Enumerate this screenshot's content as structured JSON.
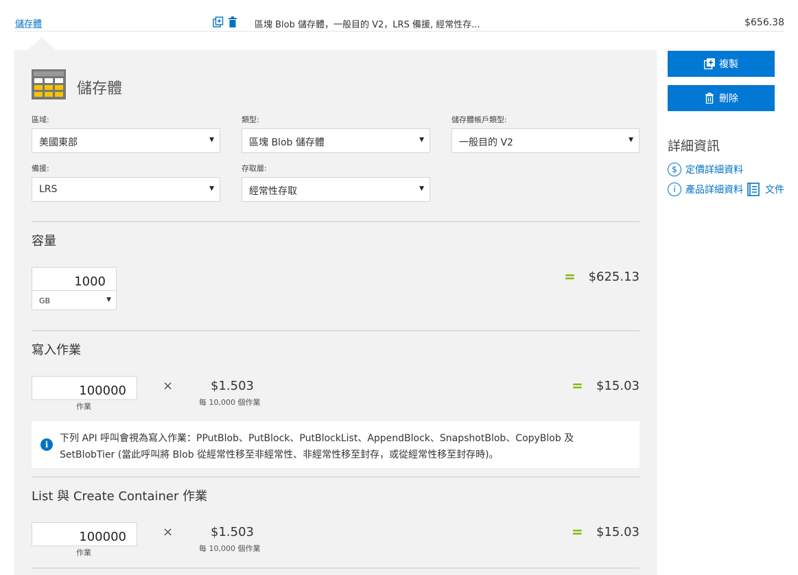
{
  "header": {
    "title": "儲存體",
    "description": "區塊 Blob 儲存體，一般目的 V2，LRS 備援, 經常性存...",
    "price": "$656.38"
  },
  "product": {
    "title": "儲存體"
  },
  "fields": {
    "region": {
      "label": "區域:",
      "value": "美國東部"
    },
    "type": {
      "label": "類型:",
      "value": "區塊 Blob 儲存體"
    },
    "account_type": {
      "label": "儲存體帳戶類型:",
      "value": "一般目的 V2"
    },
    "redundancy": {
      "label": "備援:",
      "value": "LRS"
    },
    "access_tier": {
      "label": "存取層:",
      "value": "經常性存取"
    }
  },
  "capacity": {
    "title": "容量",
    "value": "1000",
    "unit": "GB",
    "equals": "=",
    "amount": "$625.13"
  },
  "write_ops": {
    "title": "寫入作業",
    "value": "100000",
    "unit": "作業",
    "times": "×",
    "rate": "$1.503",
    "rate_unit": "每 10,000 個作業",
    "equals": "=",
    "amount": "$15.03",
    "note": "下列 API 呼叫會視為寫入作業：PPutBlob、PutBlock、PutBlockList、AppendBlock、SnapshotBlob、CopyBlob 及 SetBlobTier (當此呼叫將 Blob 從經常性移至非經常性、非經常性移至封存，或從經常性移至封存時)。"
  },
  "list_ops": {
    "title": "List 與 Create Container 作業",
    "value": "100000",
    "unit": "作業",
    "times": "×",
    "rate": "$1.503",
    "rate_unit": "每 10,000 個作業",
    "equals": "=",
    "amount": "$15.03"
  },
  "sidebar": {
    "copy_label": "複製",
    "delete_label": "刪除",
    "details_title": "詳細資訊",
    "pricing_link": "定價詳細資料",
    "product_link": "產品詳細資料",
    "docs_link": "文件"
  },
  "colors": {
    "accent": "#0078d4",
    "link": "#0072c6",
    "equals": "#7fba00",
    "panel": "#f2f2f2"
  }
}
